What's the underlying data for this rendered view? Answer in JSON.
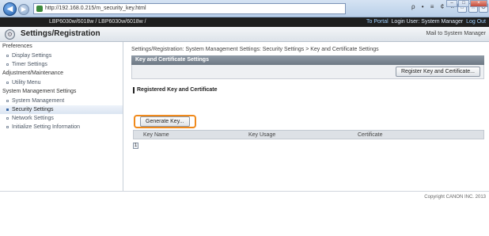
{
  "browser": {
    "url": "http://192.168.0.215/m_security_key.html",
    "tools": "ρ • ≡ ¢ ×",
    "back_icon": "arrow-left-icon",
    "forward_icon": "arrow-right-icon"
  },
  "printer": {
    "model": "LBP6030w/6018w / LBP6030w/6018w /",
    "portal_link": "To Portal",
    "login_text": "Login User: System Manager",
    "logout_link": "Log Out"
  },
  "titlebar": {
    "title": "Settings/Registration",
    "mail_link": "Mail to System Manager"
  },
  "sidebar": {
    "sections": [
      {
        "label": "Preferences",
        "items": [
          {
            "label": "Display Settings",
            "active": false
          },
          {
            "label": "Timer Settings",
            "active": false
          }
        ]
      },
      {
        "label": "Adjustment/Maintenance",
        "items": [
          {
            "label": "Utility Menu",
            "active": false
          }
        ]
      },
      {
        "label": "System Management Settings",
        "items": [
          {
            "label": "System Management",
            "active": false
          },
          {
            "label": "Security Settings",
            "active": true
          },
          {
            "label": "Network Settings",
            "active": false
          },
          {
            "label": "Initialize Setting Information",
            "active": false
          }
        ]
      }
    ]
  },
  "main": {
    "breadcrumb": "Settings/Registration: System Management Settings: Security Settings > Key and Certificate Settings",
    "section_title": "Key and Certificate Settings",
    "register_button": "Register Key and Certificate...",
    "subsection_title": "Registered Key and Certificate",
    "generate_button": "Generate Key...",
    "columns": [
      "Key Name",
      "Key Usage",
      "Certificate"
    ],
    "pager_label": "1"
  },
  "footer": {
    "copyright": "Copyright CANON INC. 2013"
  },
  "colors": {
    "highlight": "#f08a1c",
    "section_header": "#6d7884",
    "active_item": "#3b6aa8"
  }
}
